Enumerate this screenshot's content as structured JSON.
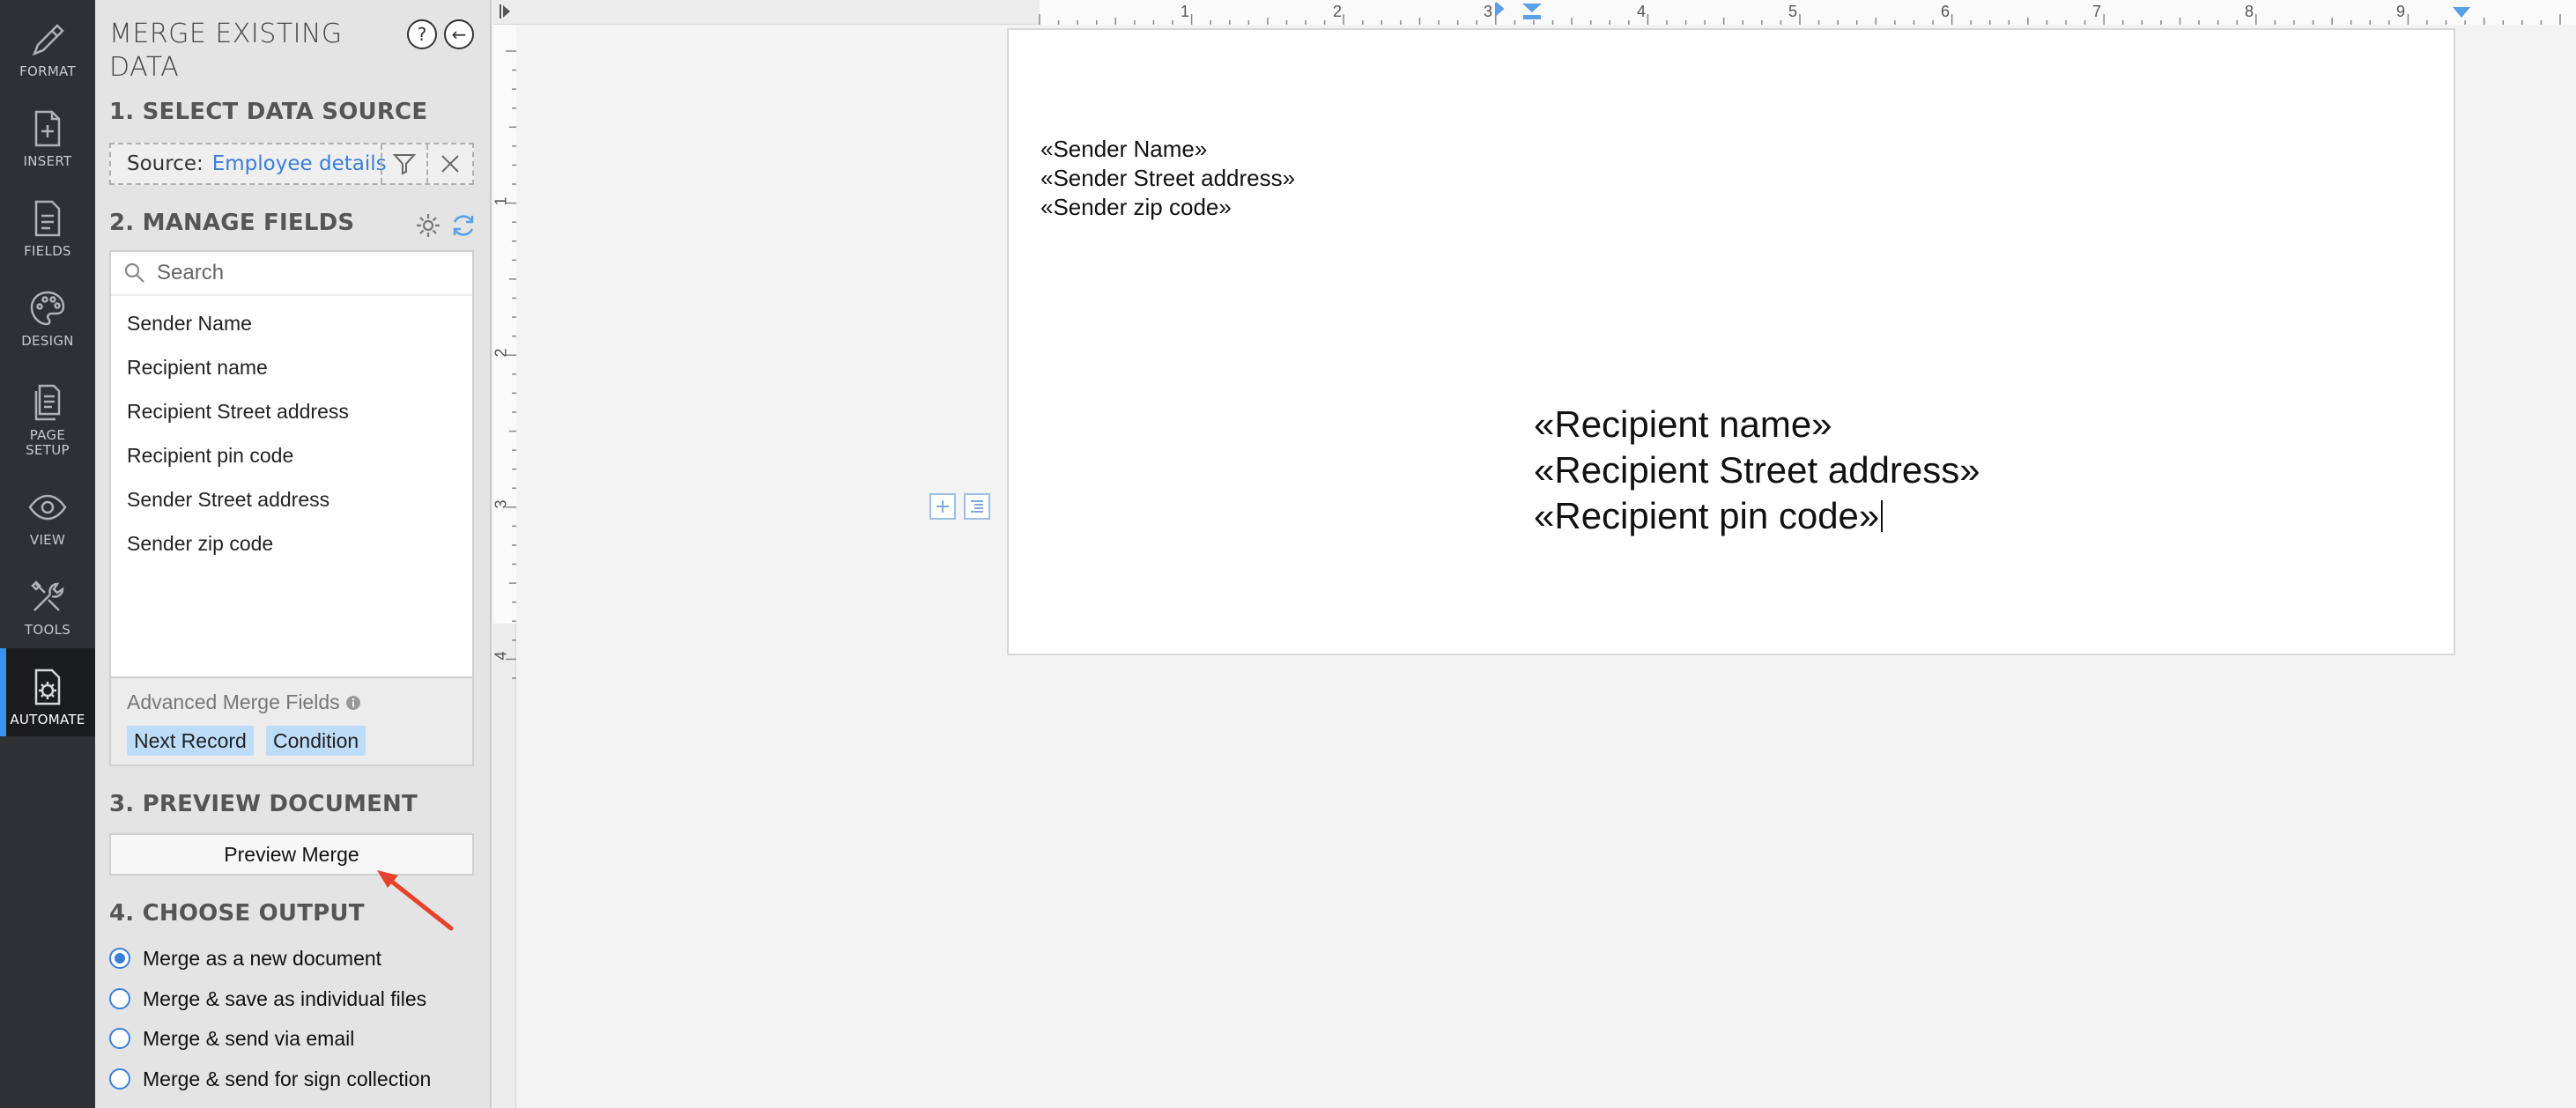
{
  "rail": {
    "items": [
      {
        "label": "FORMAT",
        "icon": "format-brush-icon"
      },
      {
        "label": "INSERT",
        "icon": "insert-doc-icon"
      },
      {
        "label": "FIELDS",
        "icon": "fields-doc-icon"
      },
      {
        "label": "DESIGN",
        "icon": "palette-icon"
      },
      {
        "label": "PAGE SETUP",
        "icon": "page-setup-icon"
      },
      {
        "label": "VIEW",
        "icon": "eye-icon"
      },
      {
        "label": "TOOLS",
        "icon": "tools-icon"
      },
      {
        "label": "AUTOMATE",
        "icon": "automate-gear-icon"
      }
    ],
    "active": "AUTOMATE",
    "active_color": "#3b8ff5"
  },
  "panel": {
    "title": "MERGE EXISTING DATA",
    "help_glyph": "?",
    "back_glyph": "←",
    "step1": {
      "heading": "1. SELECT DATA SOURCE",
      "source_label": "Source:",
      "source_value": "Employee details"
    },
    "step2": {
      "heading": "2. MANAGE FIELDS",
      "search_placeholder": "Search",
      "fields": [
        "Sender Name",
        "Recipient name",
        "Recipient Street address",
        "Recipient pin code",
        "Sender Street address",
        "Sender zip code"
      ],
      "advanced_title": "Advanced Merge Fields",
      "advanced_chips": [
        "Next Record",
        "Condition"
      ]
    },
    "step3": {
      "heading": "3. PREVIEW DOCUMENT",
      "preview_button": "Preview Merge"
    },
    "step4": {
      "heading": "4. CHOOSE OUTPUT",
      "options": [
        {
          "label": "Merge as a new document",
          "selected": true
        },
        {
          "label": "Merge & save as individual files",
          "selected": false
        },
        {
          "label": "Merge & send via email",
          "selected": false
        },
        {
          "label": "Merge & send for sign collection",
          "selected": false
        }
      ]
    }
  },
  "ruler": {
    "h_numbers": [
      "1",
      "2",
      "3",
      "4",
      "5",
      "6",
      "7",
      "8",
      "9"
    ],
    "v_numbers": [
      "1",
      "2",
      "3",
      "4"
    ]
  },
  "document": {
    "sender_lines": [
      "«Sender Name»",
      "«Sender Street address»",
      "«Sender zip code»"
    ],
    "recipient_lines": [
      "«Recipient name»",
      "«Recipient Street address»",
      "«Recipient pin code»"
    ]
  },
  "colors": {
    "link": "#3a7fd8",
    "chip": "#bcdcf7",
    "annotation_arrow": "#e8412c"
  }
}
